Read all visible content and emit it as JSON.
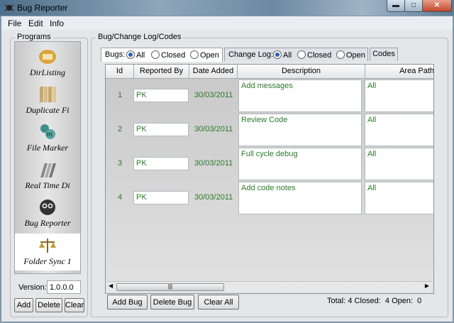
{
  "window": {
    "title": "Bug Reporter",
    "minimize": "▬",
    "maximize": "□",
    "close": "✕"
  },
  "menu": [
    "File",
    "Edit",
    "Info"
  ],
  "programs": {
    "label": "Programs",
    "items": [
      {
        "label": "DirListing",
        "icon": "dirlisting-icon",
        "selected": false
      },
      {
        "label": "Duplicate Fi",
        "icon": "duplicate-files-icon",
        "selected": false
      },
      {
        "label": "File Marker",
        "icon": "file-marker-icon",
        "selected": false
      },
      {
        "label": "Real Time Di",
        "icon": "real-time-icon",
        "selected": false
      },
      {
        "label": "Bug Reporter",
        "icon": "bug-reporter-icon",
        "selected": false
      },
      {
        "label": "Folder Sync 1",
        "icon": "folder-sync-icon",
        "selected": true
      }
    ],
    "version_label": "Version:",
    "version_value": "1.0.0.0",
    "buttons": {
      "add": "Add",
      "delete": "Delete",
      "clear": "Clear"
    }
  },
  "log": {
    "label": "Bug/Change Log/Codes",
    "bugs_tab": {
      "label": "Bugs:",
      "options": [
        "All",
        "Closed",
        "Open"
      ],
      "selected": "All"
    },
    "changelog_tab": {
      "label": "Change Log:",
      "options": [
        "All",
        "Closed",
        "Open"
      ],
      "selected": "All"
    },
    "codes_tab": "Codes",
    "columns": [
      "Id",
      "Reported By",
      "Date Added",
      "Description",
      "Area Path"
    ],
    "rows": [
      {
        "id": "1",
        "reported_by": "PK",
        "date": "30/03/2011",
        "description": "Add messages",
        "area": "All"
      },
      {
        "id": "2",
        "reported_by": "PK",
        "date": "30/03/2011",
        "description": "Review Code",
        "area": "All"
      },
      {
        "id": "3",
        "reported_by": "PK",
        "date": "30/03/2011",
        "description": "Full cycle debug",
        "area": "All"
      },
      {
        "id": "4",
        "reported_by": "PK",
        "date": "30/03/2011",
        "description": "Add code notes",
        "area": "All"
      }
    ],
    "scroll_grip": "|||",
    "buttons": {
      "add": "Add Bug",
      "delete": "Delete Bug",
      "clear": "Clear All"
    },
    "status": {
      "total_label": "Total:",
      "total": "4",
      "closed_label": "Closed:",
      "closed": "4",
      "open_label": "Open:",
      "open": "0"
    }
  }
}
